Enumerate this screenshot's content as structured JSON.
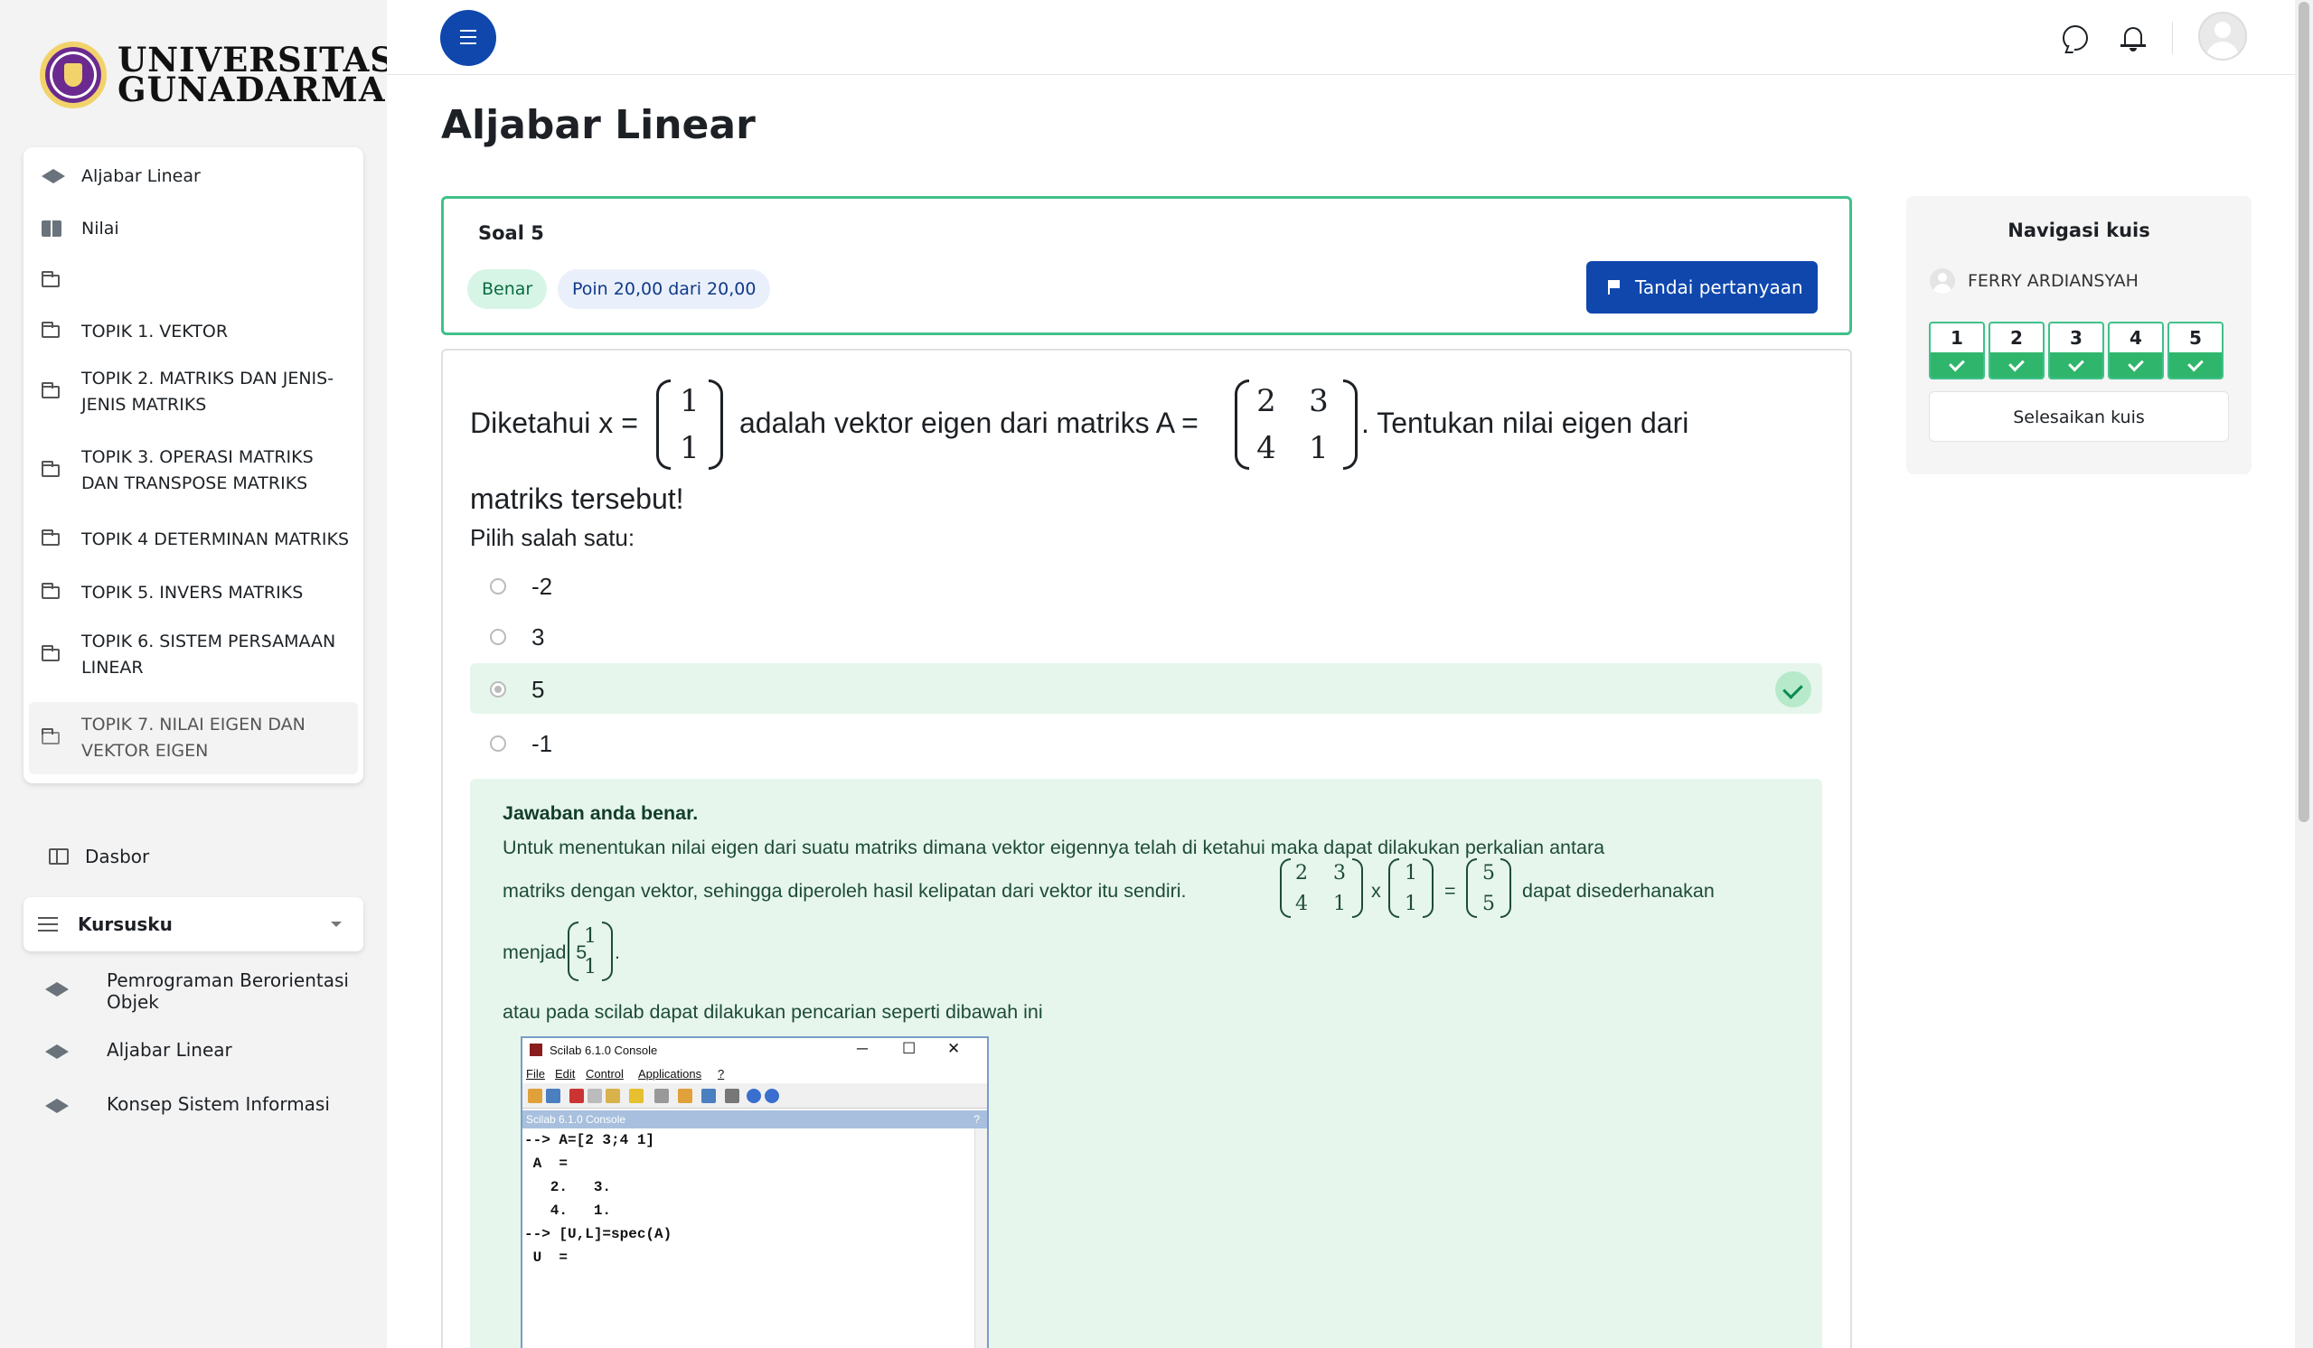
{
  "brand": {
    "line1": "UNIVERSITAS",
    "line2": "GUNADARMA"
  },
  "course_index": [
    {
      "label": "Aljabar Linear",
      "icon": "graduation-cap-icon"
    },
    {
      "label": "Nilai",
      "icon": "book-icon"
    },
    {
      "label": "",
      "icon": "folder-icon"
    },
    {
      "label": "TOPIK 1. VEKTOR",
      "icon": "folder-icon"
    },
    {
      "label": "TOPIK 2. MATRIKS DAN JENIS-JENIS MATRIKS",
      "icon": "folder-icon"
    },
    {
      "label": "TOPIK 3. OPERASI MATRIKS DAN TRANSPOSE MATRIKS",
      "icon": "folder-icon"
    },
    {
      "label": "TOPIK 4 DETERMINAN MATRIKS",
      "icon": "folder-icon"
    },
    {
      "label": "TOPIK 5. INVERS MATRIKS",
      "icon": "folder-icon"
    },
    {
      "label": "TOPIK 6. SISTEM PERSAMAAN LINEAR",
      "icon": "folder-icon"
    },
    {
      "label": "TOPIK 7. NILAI EIGEN DAN VEKTOR EIGEN",
      "icon": "folder-icon",
      "active": true
    }
  ],
  "nav": {
    "dashboard": "Dasbor",
    "my_courses_label": "Kursusku",
    "my_courses": [
      "Pemrograman Berorientasi Objek",
      "Aljabar Linear",
      "Konsep Sistem Informasi"
    ]
  },
  "page_title": "Aljabar Linear",
  "question_info": {
    "number_label": "Soal 5",
    "state": "Benar",
    "grade": "Poin 20,00 dari 20,00",
    "flag_label": "Tandai pertanyaan"
  },
  "question": {
    "part1": "Diketahui x =",
    "part2": "adalah vektor eigen dari matriks A =",
    "part3": ". Tentukan nilai eigen dari",
    "part4": "matriks tersebut!",
    "vector_x": [
      "1",
      "1"
    ],
    "matrix_a": [
      [
        "2",
        "3"
      ],
      [
        "4",
        "1"
      ]
    ],
    "prompt": "Pilih salah satu:",
    "options": [
      {
        "label": "-2",
        "selected": false
      },
      {
        "label": "3",
        "selected": false
      },
      {
        "label": "5",
        "selected": true,
        "correct": true
      },
      {
        "label": "-1",
        "selected": false
      }
    ]
  },
  "feedback": {
    "title": "Jawaban anda benar.",
    "line1": "Untuk menentukan nilai eigen dari suatu matriks dimana vektor eigennya telah di ketahui maka dapat dilakukan perkalian antara",
    "line2": "matriks dengan vektor, sehingga diperoleh hasil kelipatan dari vektor itu sendiri.",
    "times": "x",
    "equals": "=",
    "line2b": "dapat disederhanakan",
    "line3": "menjadi 5",
    "line3b": ".",
    "line4": "atau pada scilab dapat dilakukan pencarian seperti dibawah ini",
    "matrix_a": [
      [
        "2",
        "3"
      ],
      [
        "4",
        "1"
      ]
    ],
    "vector_x": [
      "1",
      "1"
    ],
    "result": [
      "5",
      "5"
    ],
    "simplified": [
      "1",
      "1"
    ]
  },
  "scilab": {
    "title": "Scilab 6.1.0 Console",
    "menu": [
      "File",
      "Edit",
      "Control",
      "Applications",
      "?"
    ],
    "console_label": "Scilab 6.1.0 Console",
    "console_help": "?",
    "lines": [
      "--> A=[2 3;4 1]",
      " A  =",
      "",
      "   2.   3.",
      "   4.   1.",
      "",
      "--> [U,L]=spec(A)",
      " U  ="
    ],
    "win_min": "─",
    "win_max": "☐",
    "win_close": "✕"
  },
  "quiz_nav": {
    "title": "Navigasi kuis",
    "user": "FERRY ARDIANSYAH",
    "questions": [
      "1",
      "2",
      "3",
      "4",
      "5"
    ],
    "finish": "Selesaikan kuis"
  },
  "colors": {
    "primary": "#0f47ad",
    "success": "#3fc18a",
    "success_bg": "#e6f6ec"
  }
}
